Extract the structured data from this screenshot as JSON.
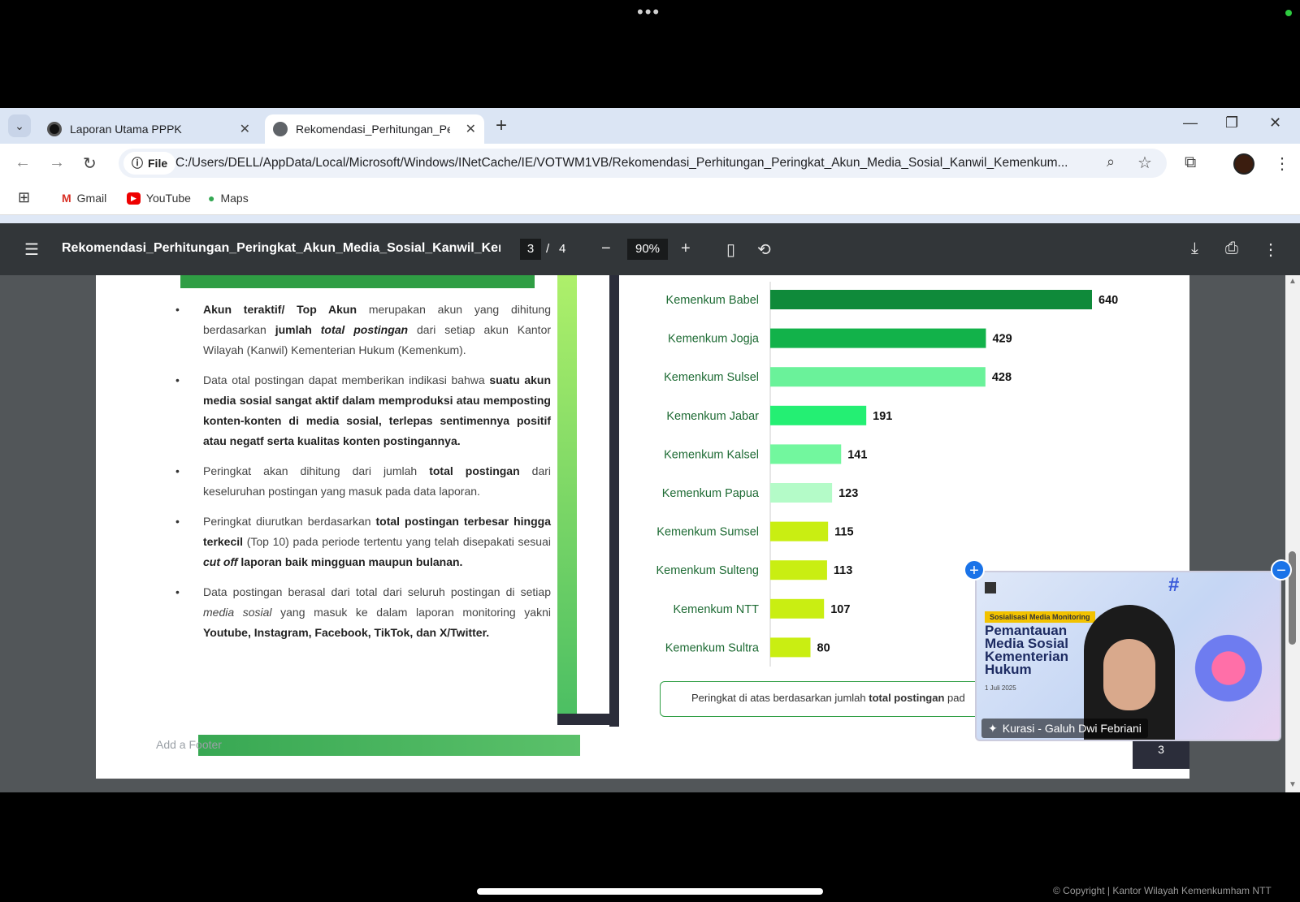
{
  "tabs": [
    {
      "title": "Laporan Utama PPPK",
      "active": false
    },
    {
      "title": "Rekomendasi_Perhitungan_Peri",
      "active": true
    }
  ],
  "address_bar": {
    "scheme_label": "File",
    "url": "C:/Users/DELL/AppData/Local/Microsoft/Windows/INetCache/IE/VOTWM1VB/Rekomendasi_Perhitungan_Peringkat_Akun_Media_Sosial_Kanwil_Kemenkum..."
  },
  "bookmarks": [
    {
      "label": "Gmail",
      "icon": "gmail-icon"
    },
    {
      "label": "YouTube",
      "icon": "youtube-icon"
    },
    {
      "label": "Maps",
      "icon": "maps-icon"
    }
  ],
  "pdf_toolbar": {
    "title": "Rekomendasi_Perhitungan_Peringkat_Akun_Media_Sosial_Kanwil_Keme...",
    "current_page": "3",
    "page_separator": "/",
    "total_pages": "4",
    "zoom": "90%"
  },
  "document": {
    "footer_placeholder": "Add a Footer",
    "page_number": "3",
    "chart_note_text": "Peringkat di atas berdasarkan jumlah ",
    "chart_note_bold": "total postingan",
    "chart_note_tail": " pad"
  },
  "bullets": [
    [
      {
        "t": "Akun teraktif/ Top Akun",
        "b": true
      },
      {
        "t": " merupakan akun yang dihitung berdasarkan ",
        "b": false
      },
      {
        "t": "jumlah ",
        "b": true
      },
      {
        "t": "total postingan",
        "b": true,
        "i": true
      },
      {
        "t": " dari setiap akun Kantor Wilayah (Kanwil) Kementerian Hukum (Kemenkum).",
        "b": false
      }
    ],
    [
      {
        "t": "Data otal postingan dapat memberikan indikasi bahwa ",
        "b": false
      },
      {
        "t": "suatu akun  media sosial sangat aktif dalam memproduksi atau memposting konten-konten di media sosial, terlepas sentimennya positif atau negatf serta kualitas konten postingannya.",
        "b": true
      }
    ],
    [
      {
        "t": "Peringkat akan dihitung dari jumlah ",
        "b": false
      },
      {
        "t": "total postingan",
        "b": true
      },
      {
        "t": " dari keseluruhan postingan yang masuk pada data laporan.",
        "b": false
      }
    ],
    [
      {
        "t": "Peringkat diurutkan berdasarkan ",
        "b": false
      },
      {
        "t": "total postingan terbesar hingga terkecil",
        "b": true
      },
      {
        "t": " (Top 10) pada periode tertentu yang telah disepakati sesuai ",
        "b": false
      },
      {
        "t": "cut off",
        "b": true,
        "i": true
      },
      {
        "t": " laporan baik mingguan maupun bulanan.",
        "b": true
      }
    ],
    [
      {
        "t": "Data postingan berasal dari total dari seluruh postingan di setiap   ",
        "b": false
      },
      {
        "t": "media sosial",
        "b": false,
        "i": true
      },
      {
        "t": " yang masuk ke dalam laporan monitoring yakni ",
        "b": false
      },
      {
        "t": "Youtube, Instagram, Facebook, TikTok, dan X/Twitter.",
        "b": true
      }
    ]
  ],
  "chart_data": {
    "type": "bar",
    "orientation": "horizontal",
    "categories": [
      "Kemenkum Babel",
      "Kemenkum Jogja",
      "Kemenkum Sulsel",
      "Kemenkum Jabar",
      "Kemenkum Kalsel",
      "Kemenkum Papua",
      "Kemenkum Sumsel",
      "Kemenkum Sulteng",
      "Kemenkum NTT",
      "Kemenkum Sultra"
    ],
    "values": [
      640,
      429,
      428,
      191,
      141,
      123,
      115,
      113,
      107,
      80
    ],
    "colors": [
      "#0f8a3a",
      "#12b24a",
      "#6af29a",
      "#24ef73",
      "#72f79e",
      "#b4fbc8",
      "#c9ee12",
      "#c9ee12",
      "#c9ee12",
      "#c9ee12"
    ],
    "xlim": [
      0,
      640
    ],
    "data_labels": true,
    "grid": false
  },
  "video_overlay": {
    "tag": "Sosialisasi Media Monitoring",
    "title": "Pemantauan Media Sosial Kementerian Hukum",
    "date": "1 Juli 2025",
    "hashtag": "#",
    "participant_label": "Kurasi - Galuh Dwi Febriani"
  },
  "copyright": "© Copyright | Kantor Wilayah Kemenkumham NTT",
  "colors": {
    "accent_green": "#2f9e44",
    "pdf_toolbar": "#323639",
    "video_button": "#1a73e8"
  }
}
